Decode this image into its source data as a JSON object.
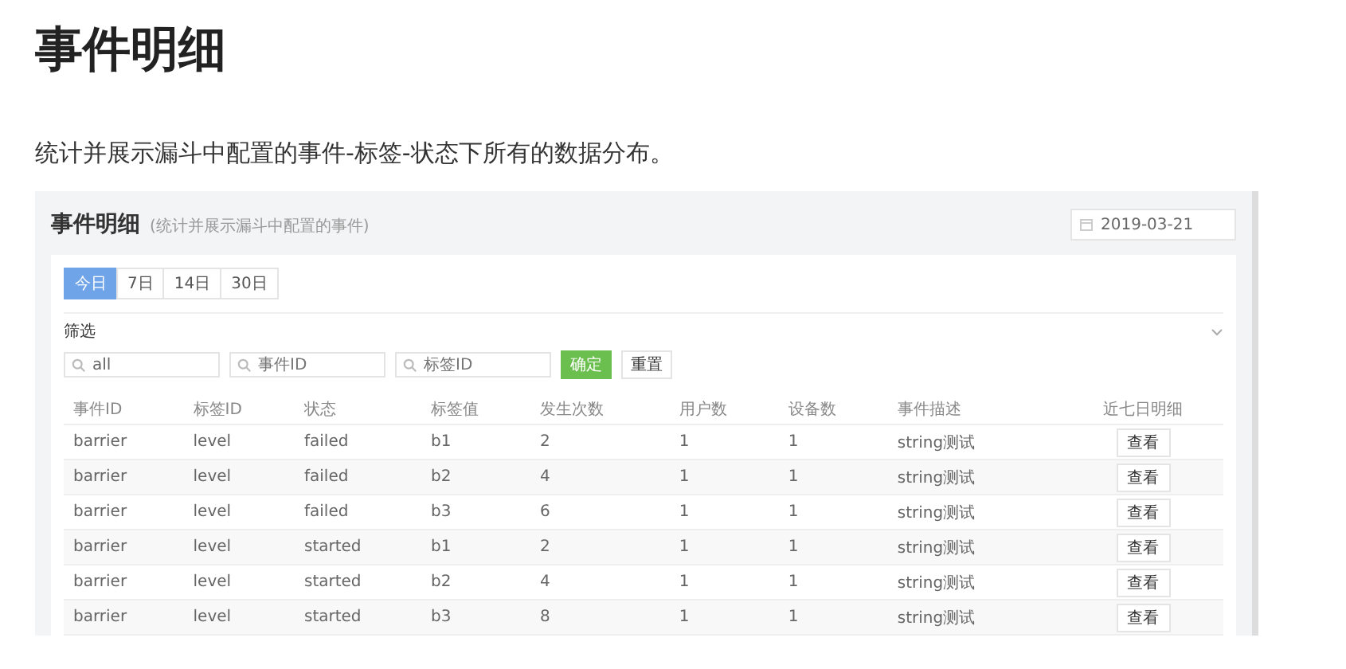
{
  "page": {
    "title": "事件明细",
    "description": "统计并展示漏斗中配置的事件-标签-状态下所有的数据分布。"
  },
  "screenshot": {
    "title": "事件明细",
    "subtitle": "(统计并展示漏斗中配置的事件)",
    "date": "2019-03-21",
    "tabs": [
      {
        "label": "今日",
        "selected": true
      },
      {
        "label": "7日",
        "selected": false
      },
      {
        "label": "14日",
        "selected": false
      },
      {
        "label": "30日",
        "selected": false
      }
    ],
    "filter": {
      "label": "筛选",
      "expanded": false,
      "fields": [
        {
          "value": "all"
        },
        {
          "placeholder": "事件ID"
        },
        {
          "placeholder": "标签ID"
        }
      ],
      "buttons": [
        {
          "label": "确定",
          "kind": "primary"
        },
        {
          "label": "重置",
          "kind": "default"
        }
      ]
    },
    "table": {
      "columns": [
        "事件ID",
        "标签ID",
        "状态",
        "标签值",
        "发生次数",
        "用户数",
        "设备数",
        "事件描述",
        "近七日明细"
      ],
      "rows": [
        [
          "barrier",
          "level",
          "failed",
          "b1",
          "2",
          "1",
          "1",
          "string测试",
          "查看"
        ],
        [
          "barrier",
          "level",
          "failed",
          "b2",
          "4",
          "1",
          "1",
          "string测试",
          "查看"
        ],
        [
          "barrier",
          "level",
          "failed",
          "b3",
          "6",
          "1",
          "1",
          "string测试",
          "查看"
        ],
        [
          "barrier",
          "level",
          "started",
          "b1",
          "2",
          "1",
          "1",
          "string测试",
          "查看"
        ],
        [
          "barrier",
          "level",
          "started",
          "b2",
          "4",
          "1",
          "1",
          "string测试",
          "查看"
        ],
        [
          "barrier",
          "level",
          "started",
          "b3",
          "8",
          "1",
          "1",
          "string测试",
          "查看"
        ]
      ]
    }
  }
}
